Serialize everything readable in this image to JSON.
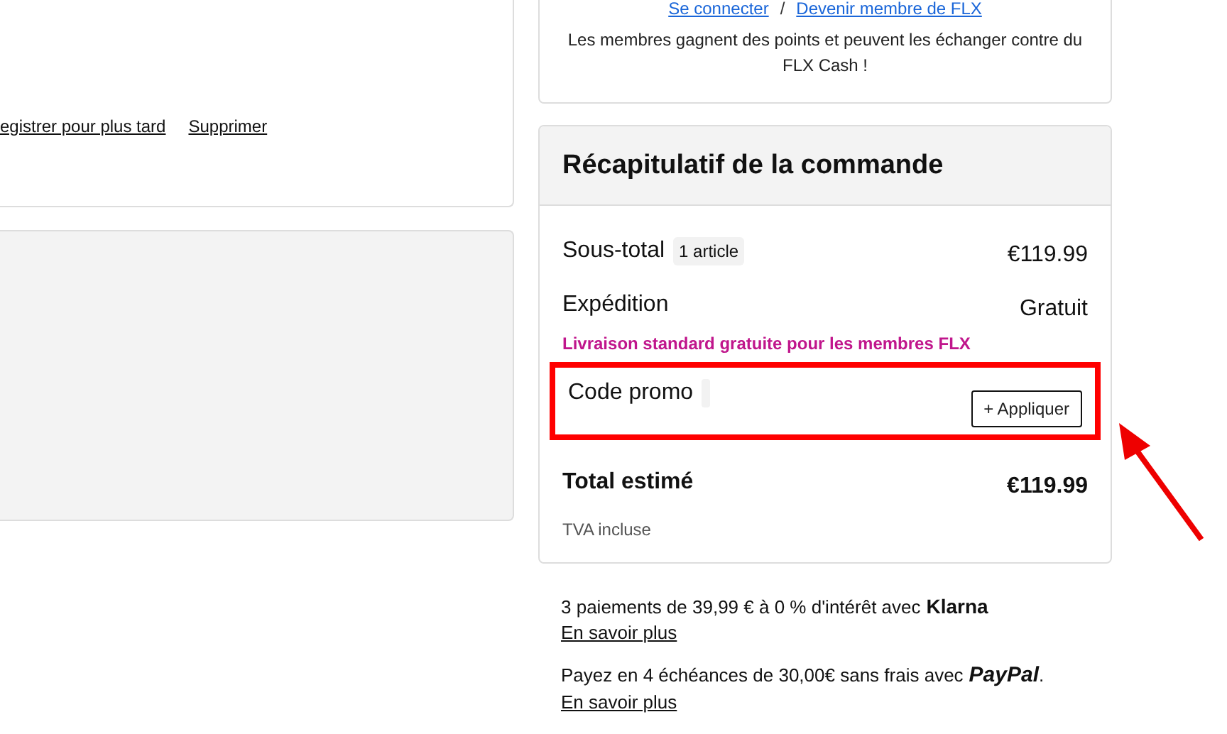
{
  "cart_item": {
    "actions": [
      {
        "label": "egistrer pour plus tard"
      },
      {
        "label": "Supprimer"
      }
    ]
  },
  "membership": {
    "links": [
      {
        "label": "Se connecter"
      },
      {
        "label": "Devenir membre de FLX"
      }
    ],
    "separator": "/",
    "text": "Les membres gagnent des points et peuvent les échanger contre du FLX Cash !"
  },
  "summary": {
    "title": "Récapitulatif de la commande",
    "subtotal": {
      "label": "Sous-total",
      "badge": "1 article",
      "value": "€119.99"
    },
    "shipping": {
      "label": "Expédition",
      "value": "Gratuit",
      "note": "Livraison standard gratuite pour les membres FLX"
    },
    "promo": {
      "label": "Code promo",
      "button": "+ Appliquer",
      "highlighted": true
    },
    "total": {
      "label": "Total estimé",
      "value": "€119.99",
      "note": "TVA incluse"
    }
  },
  "payments": [
    {
      "text": "3 paiements de 39,99 € à 0 % d'intérêt avec",
      "logo": "Klarna",
      "kind": "klarna",
      "link": "En savoir plus"
    },
    {
      "text": "Payez en 4 échéances de 30,00€ sans frais avec",
      "logo": "PayPal",
      "kind": "paypal",
      "trail": ".",
      "link": "En savoir plus"
    }
  ]
}
